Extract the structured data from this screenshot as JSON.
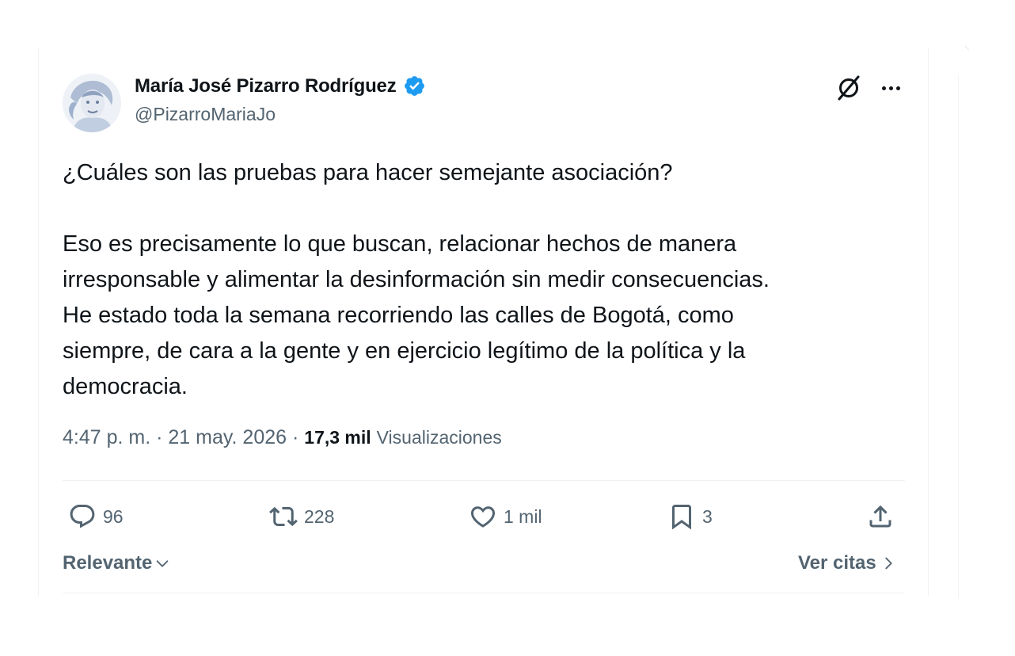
{
  "author": {
    "display_name": "María José Pizarro Rodríguez",
    "handle": "@PizarroMariaJo",
    "verified": true,
    "verified_color": "#1d9bf0"
  },
  "tweet": {
    "paragraphs": [
      [
        "¿Cuáles son las pruebas para hacer semejante asociación?"
      ],
      [
        "Eso es precisamente lo que buscan, relacionar hechos de manera",
        "irresponsable y alimentar la desinformación sin medir consecuencias.",
        "He estado toda la semana recorriendo las calles de Bogotá, como",
        "siempre, de cara a la gente y en ejercicio legítimo de la política y la",
        "democracia."
      ]
    ]
  },
  "meta": {
    "time": "4:47 p. m.",
    "separator": "·",
    "date": "21 may. 2026",
    "views_count": "17,3 mil",
    "views_label": "Visualizaciones"
  },
  "actions": {
    "reply": {
      "icon": "reply-icon",
      "count": "96"
    },
    "retweet": {
      "icon": "retweet-icon",
      "count": "228"
    },
    "like": {
      "icon": "heart-icon",
      "count": "1 mil"
    },
    "bookmark": {
      "icon": "bookmark-icon",
      "count": "3"
    },
    "share": {
      "icon": "share-icon"
    }
  },
  "footer": {
    "sort_label": "Relevante",
    "quotes_label": "Ver citas"
  },
  "colors": {
    "text": "#0f1419",
    "secondary": "#536471",
    "divider": "#eff3f4"
  }
}
